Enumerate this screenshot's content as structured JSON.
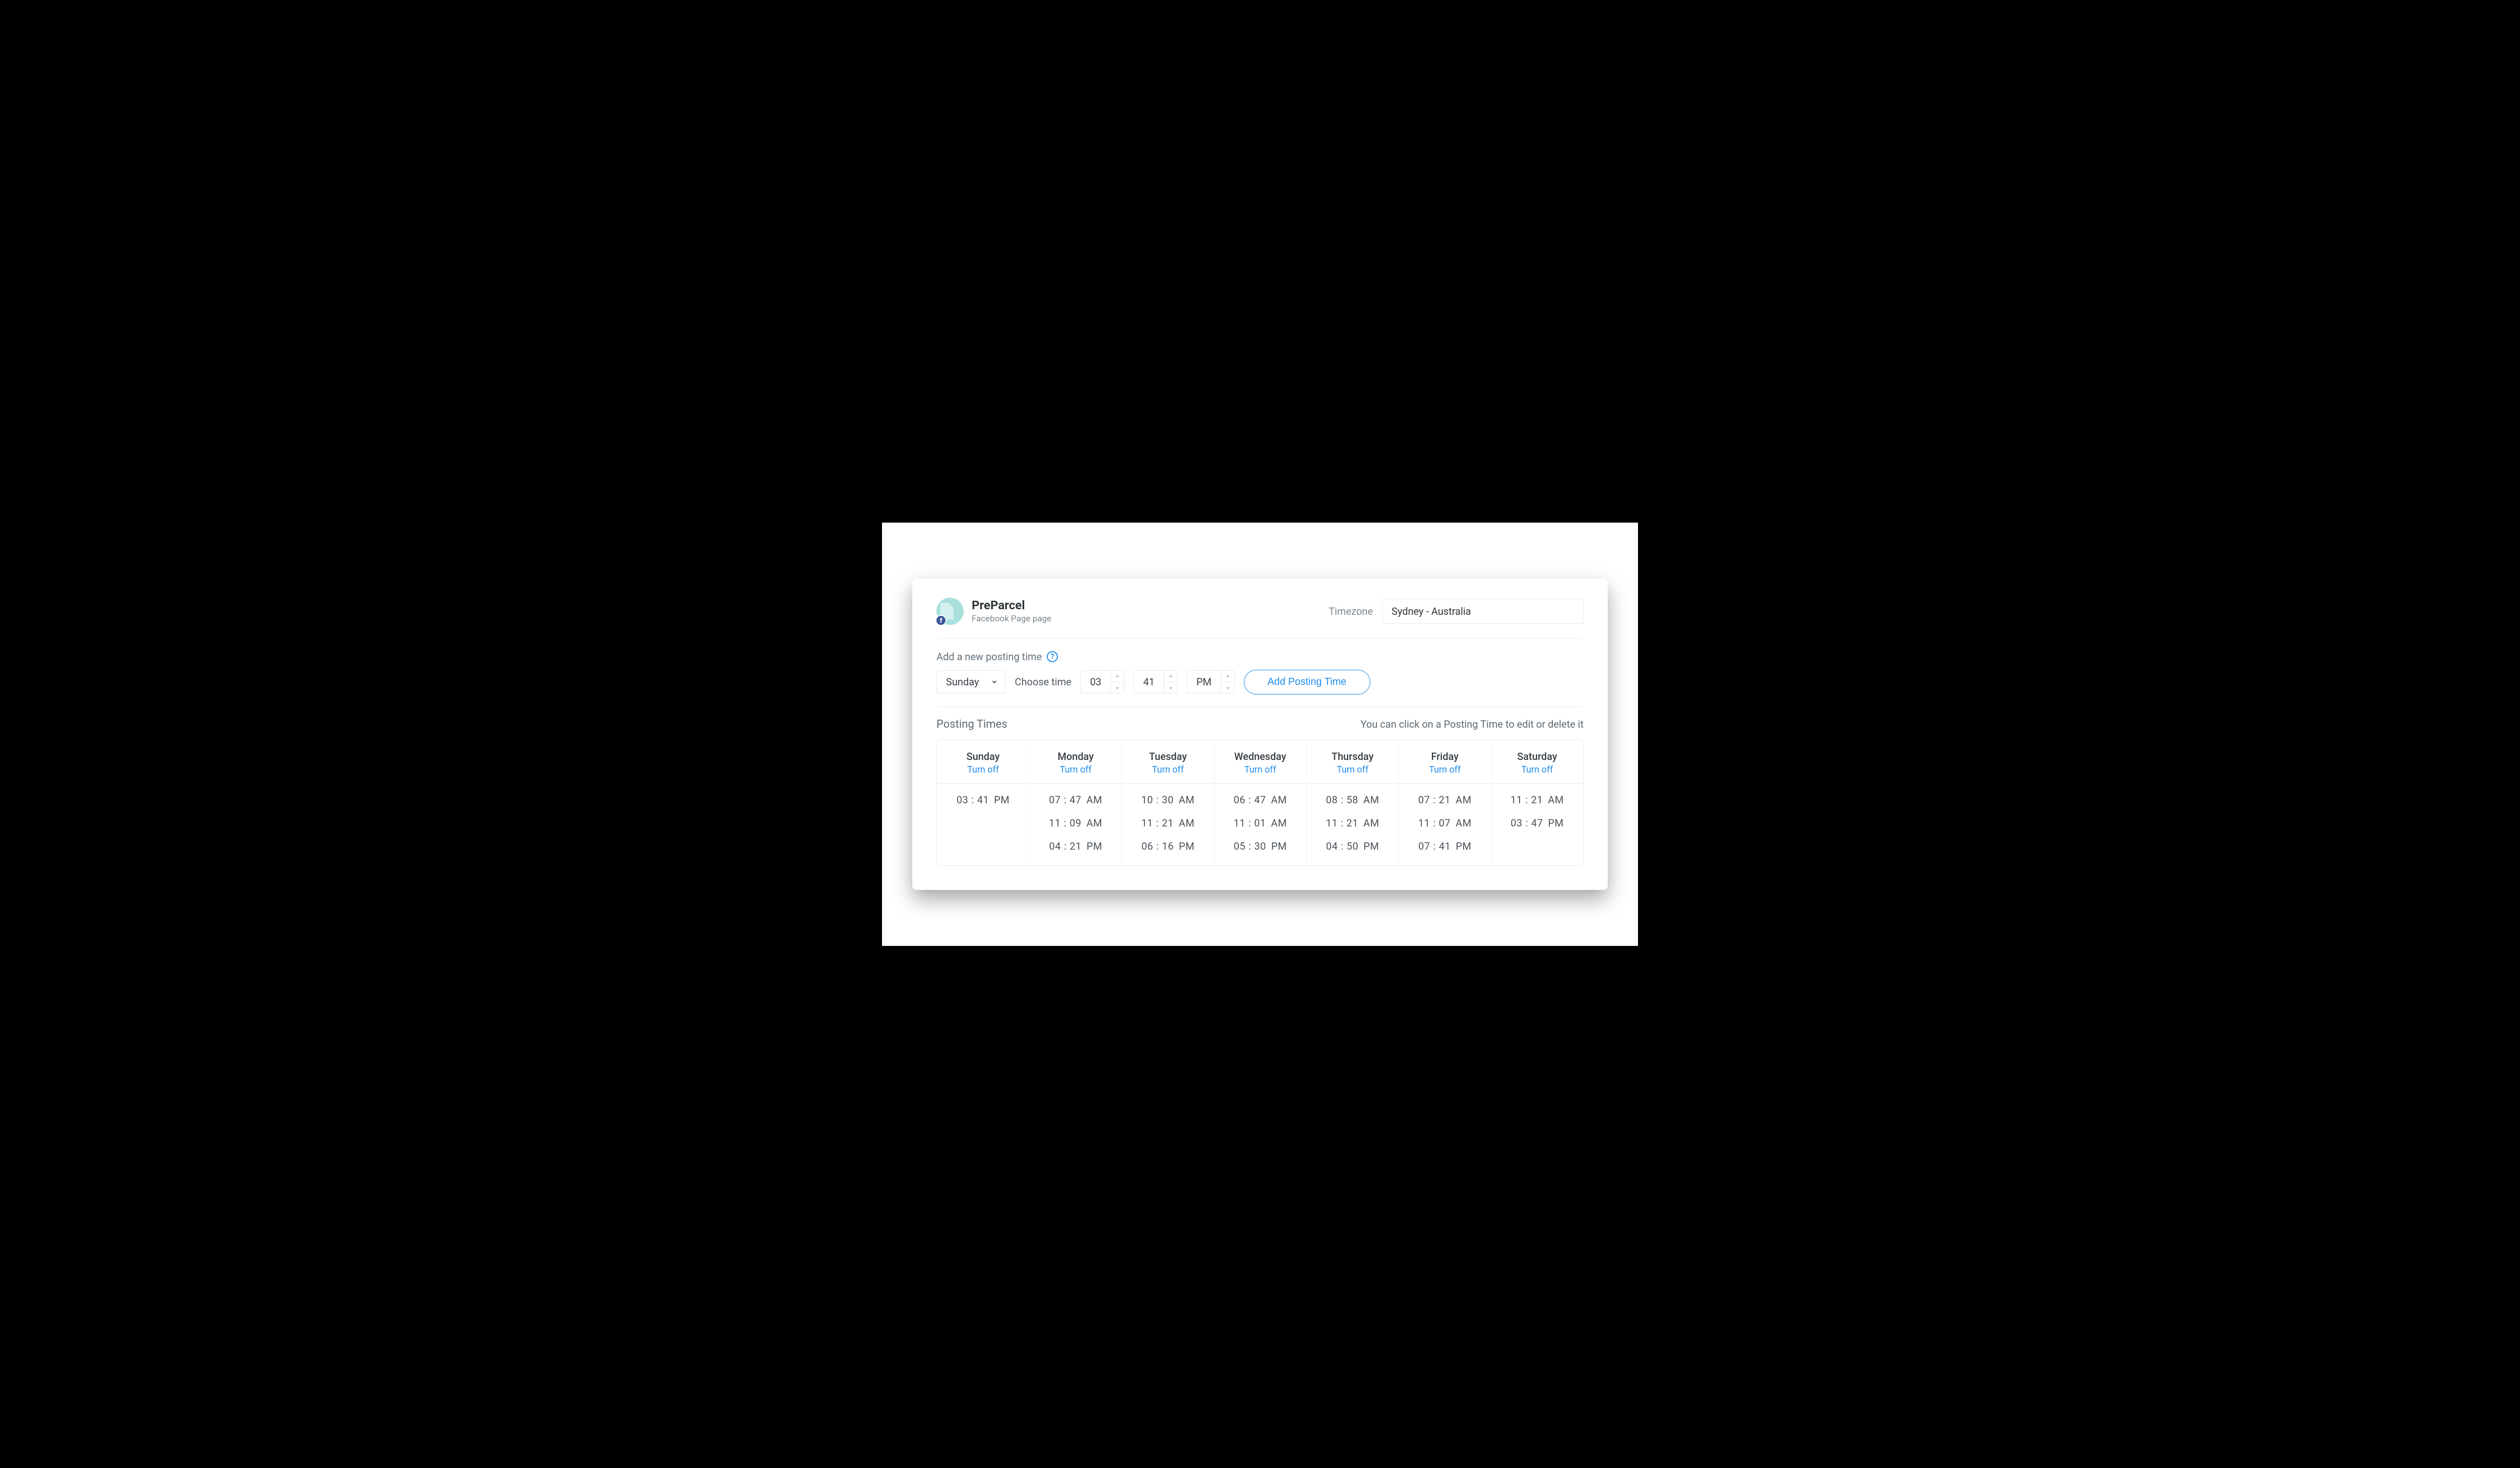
{
  "account": {
    "name": "PreParcel",
    "subtitle": "Facebook Page page",
    "badge_letter": "f"
  },
  "timezone": {
    "label": "Timezone",
    "value": "Sydney - Australia"
  },
  "add": {
    "title": "Add a new posting time",
    "day": "Sunday",
    "choose_label": "Choose time",
    "hour": "03",
    "minute": "41",
    "meridiem": "PM",
    "button": "Add Posting Time"
  },
  "posting_times": {
    "title": "Posting Times",
    "hint": "You can click on a Posting Time to edit or delete it",
    "turn_off_label": "Turn off",
    "days": [
      {
        "name": "Sunday",
        "slots": [
          {
            "h": "03",
            "m": "41",
            "p": "PM"
          }
        ]
      },
      {
        "name": "Monday",
        "slots": [
          {
            "h": "07",
            "m": "47",
            "p": "AM"
          },
          {
            "h": "11",
            "m": "09",
            "p": "AM"
          },
          {
            "h": "04",
            "m": "21",
            "p": "PM"
          }
        ]
      },
      {
        "name": "Tuesday",
        "slots": [
          {
            "h": "10",
            "m": "30",
            "p": "AM"
          },
          {
            "h": "11",
            "m": "21",
            "p": "AM"
          },
          {
            "h": "06",
            "m": "16",
            "p": "PM"
          }
        ]
      },
      {
        "name": "Wednesday",
        "slots": [
          {
            "h": "06",
            "m": "47",
            "p": "AM"
          },
          {
            "h": "11",
            "m": "01",
            "p": "AM"
          },
          {
            "h": "05",
            "m": "30",
            "p": "PM"
          }
        ]
      },
      {
        "name": "Thursday",
        "slots": [
          {
            "h": "08",
            "m": "58",
            "p": "AM"
          },
          {
            "h": "11",
            "m": "21",
            "p": "AM"
          },
          {
            "h": "04",
            "m": "50",
            "p": "PM"
          }
        ]
      },
      {
        "name": "Friday",
        "slots": [
          {
            "h": "07",
            "m": "21",
            "p": "AM"
          },
          {
            "h": "11",
            "m": "07",
            "p": "AM"
          },
          {
            "h": "07",
            "m": "41",
            "p": "PM"
          }
        ]
      },
      {
        "name": "Saturday",
        "slots": [
          {
            "h": "11",
            "m": "21",
            "p": "AM"
          },
          {
            "h": "03",
            "m": "47",
            "p": "PM"
          }
        ]
      }
    ]
  }
}
